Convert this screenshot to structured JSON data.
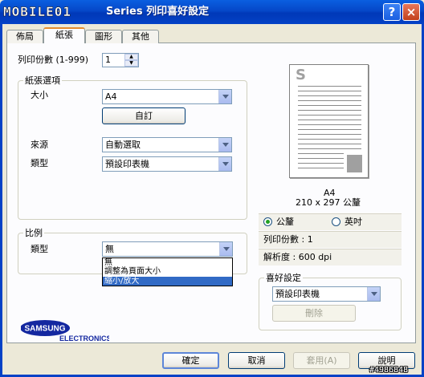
{
  "window": {
    "logo_text": "MOBILE01",
    "title": "Series 列印喜好設定",
    "help_glyph": "?",
    "close_glyph": "×"
  },
  "tabs": [
    {
      "label": "佈局"
    },
    {
      "label": "紙張",
      "active": true
    },
    {
      "label": "圖形"
    },
    {
      "label": "其他"
    }
  ],
  "copies": {
    "label": "列印份數 (1-999)",
    "value": "1"
  },
  "paper_options": {
    "legend": "紙張選項",
    "size_label": "大小",
    "size_value": "A4",
    "custom_button": "自訂",
    "source_label": "來源",
    "source_value": "自動選取",
    "type_label": "類型",
    "type_value": "預設印表機"
  },
  "scaling": {
    "legend": "比例",
    "type_label": "類型",
    "type_value": "無",
    "options": [
      "無",
      "調整為頁面大小",
      "縮小/放大"
    ],
    "highlighted_index": 2
  },
  "preview": {
    "page_letter": "S",
    "paper_name": "A4",
    "paper_dims": "210 x 297 公釐",
    "unit_mm": "公釐",
    "unit_inch": "英吋",
    "selected_unit": "mm",
    "copies_text": "列印份數 : 1",
    "resolution_text": "解析度 : 600 dpi"
  },
  "favorites": {
    "legend": "喜好設定",
    "value": "預設印表機",
    "delete_button": "刪除"
  },
  "brand": {
    "name": "SAMSUNG",
    "sub": "ELECTRONICS",
    "color": "#1428a0"
  },
  "footer": {
    "ok": "確定",
    "cancel": "取消",
    "apply": "套用(A)",
    "help": "說明"
  },
  "watermark": "#4986848"
}
